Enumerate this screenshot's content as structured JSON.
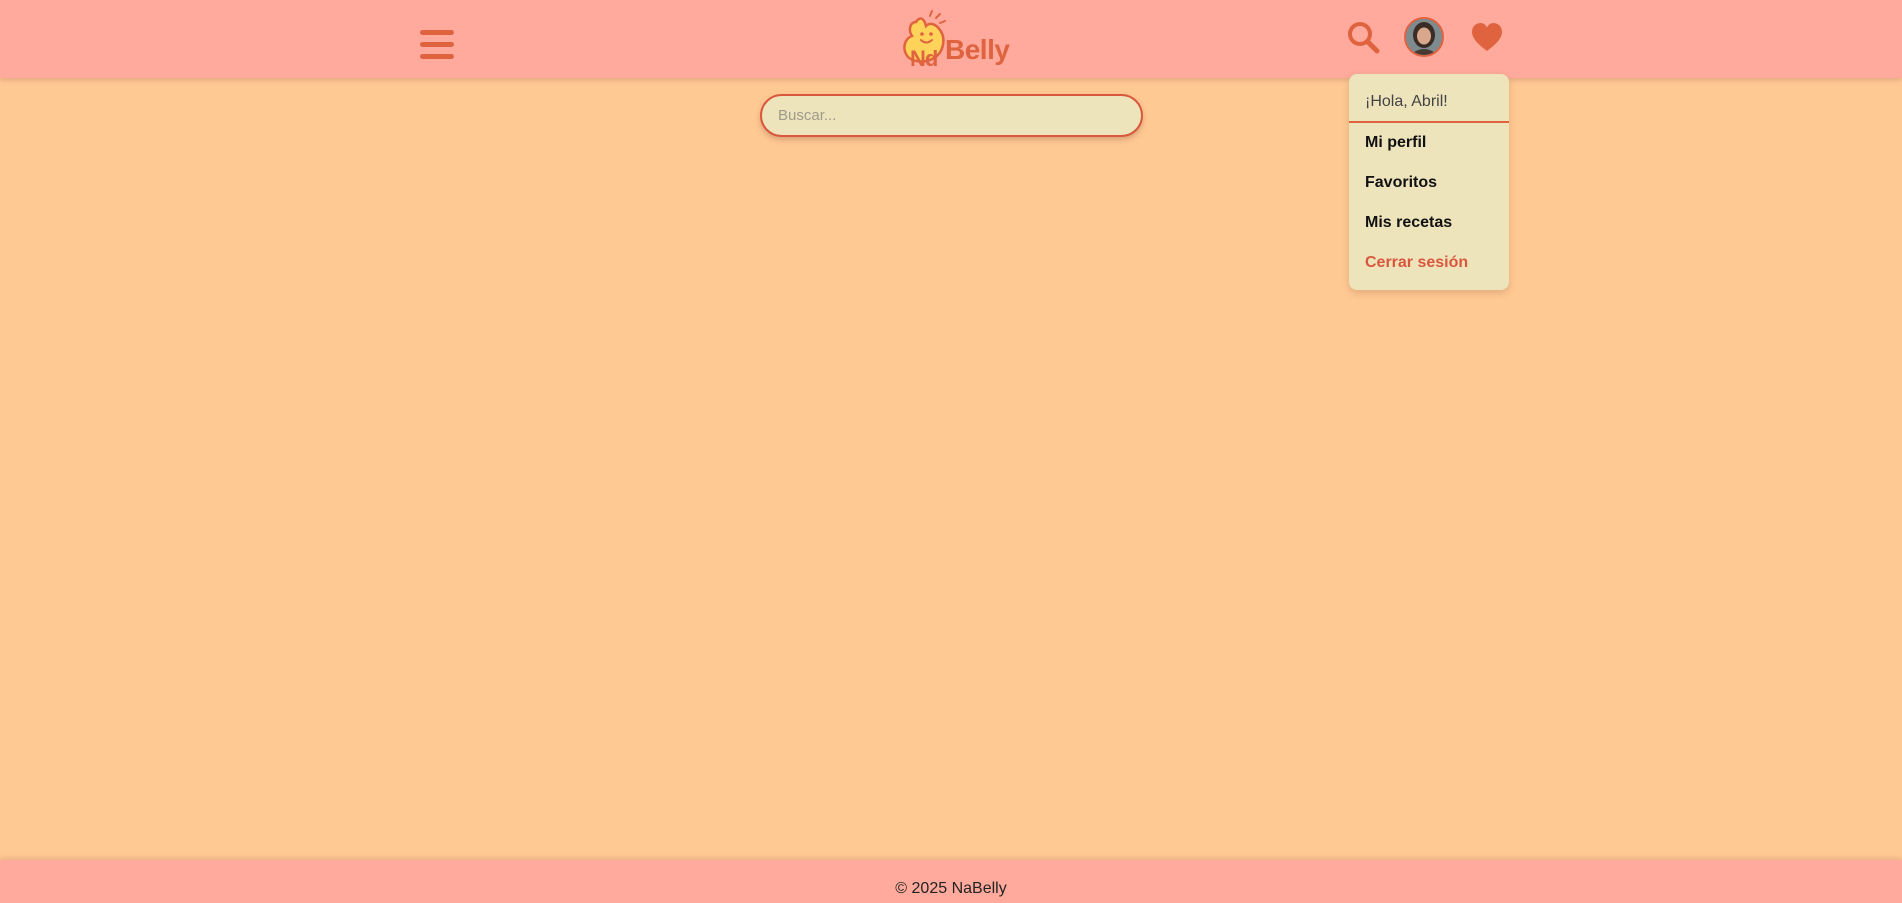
{
  "header": {
    "logo_text": "Belly",
    "logo_mark": "Nd",
    "icons": {
      "menu": "hamburger-menu-icon",
      "search": "search-icon",
      "profile": "user-avatar",
      "favorites": "heart-icon"
    }
  },
  "search": {
    "placeholder": "Buscar...",
    "value": ""
  },
  "user_menu": {
    "greeting": "¡Hola, Abril!",
    "items": [
      {
        "label": "Mi perfil"
      },
      {
        "label": "Favoritos"
      },
      {
        "label": "Mis recetas"
      },
      {
        "label": "Cerrar sesión"
      }
    ]
  },
  "footer": {
    "copyright": "© 2025 NaBelly"
  },
  "colors": {
    "header_bg": "#ffaa9c",
    "page_bg": "#ffc994",
    "accent": "#e0633f",
    "panel_bg": "#ede4bc",
    "logout": "#d9573c"
  }
}
